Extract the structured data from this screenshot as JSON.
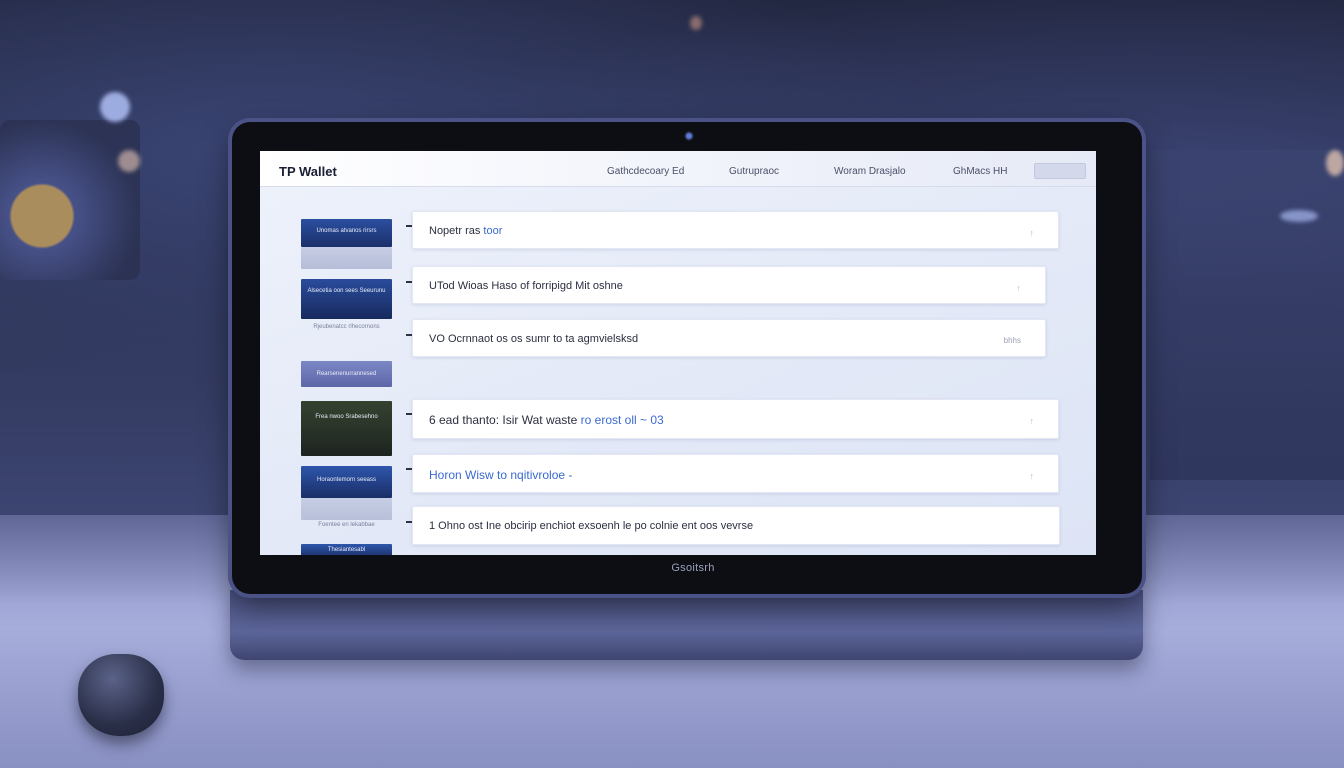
{
  "app": {
    "title": "TP Wallet"
  },
  "nav": [
    "Gathcdecoary Ed",
    "Gutrupraoc",
    "Woram Drasjalo",
    "GhMacs HH"
  ],
  "nav_button": "",
  "rows": [
    {
      "text": "Nopetr ras",
      "highlight": "toor",
      "aside": ""
    },
    {
      "text": "UTod Wioas Haso of forripigd Mit oshne",
      "highlight": "",
      "aside": ""
    },
    {
      "text": "VO Ocrnnaot os os sumr to ta agmvielsksd",
      "highlight": "",
      "aside": "bhhs"
    },
    {
      "text": "6 ead thanto: Isir Wat waste",
      "highlight": "ro erost oll ~ 03",
      "aside": ""
    },
    {
      "text": "",
      "highlight": "Horon Wisw to nqitivroloe -",
      "aside": ""
    },
    {
      "text": "1 Ohno ost Ine obcirip enchiot exsoenh le po colnie ent oos vevrse",
      "highlight": "",
      "aside": ""
    }
  ],
  "thumbnails": [
    {
      "label": "Unomas atvanos rirsrs",
      "caption": ""
    },
    {
      "label": "Alsecetia oon sees Seeurunu",
      "caption": "Rjeubenatcc rlhecornons"
    },
    {
      "label": "Rearsenenurrannesed",
      "caption": ""
    },
    {
      "label": "Frea nwoo Srabesehno",
      "caption": ""
    },
    {
      "label": "Horaontemorn seeass",
      "caption": "Foentee en lekabbae"
    },
    {
      "label": "Thesiantesabl",
      "caption": ""
    }
  ],
  "monitor_brand": "Gsoitsrh",
  "colors": {
    "accent": "#3a6ad0",
    "screen_bg": "#e6ebf8",
    "bezel": "#0c0e14"
  }
}
